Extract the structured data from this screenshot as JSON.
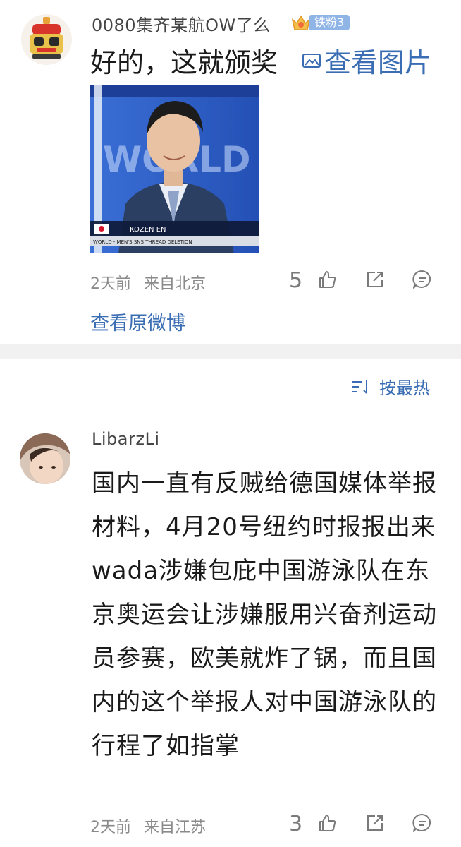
{
  "post": {
    "username": "0080集齐某航OW了么",
    "badge_label": "铁粉3",
    "content": "好的，这就颁奖",
    "view_image_label": "查看图片",
    "photo": {
      "caption_name": "KOZEN EN",
      "caption_sub": "WORLD - MEN'S SNS THREAD DELETION",
      "backdrop_text": "WORLD",
      "flag": "japan"
    },
    "time": "2天前",
    "source": "来自北京",
    "like_count": "5",
    "view_original_label": "查看原微博"
  },
  "sort_label": "按最热",
  "comment": {
    "username": "LibarzLi",
    "content": "国内一直有反贼给德国媒体举报材料，4月20号纽约时报报出来wada涉嫌包庇中国游泳队在东京奥运会让涉嫌服用兴奋剂运动员参赛，欧美就炸了锅，而且国内的这个举报人对中国游泳队的行程了如指掌",
    "time": "2天前",
    "source": "来自江苏",
    "like_count": "3"
  },
  "icons": {
    "like": "thumb-up-icon",
    "share": "share-icon",
    "comment": "comment-icon",
    "image": "image-icon",
    "sort": "sort-icon",
    "badge": "crown-icon"
  },
  "colors": {
    "link": "#3a6db3",
    "badge": "#8fb4e6",
    "meta": "#8a8a8a"
  }
}
